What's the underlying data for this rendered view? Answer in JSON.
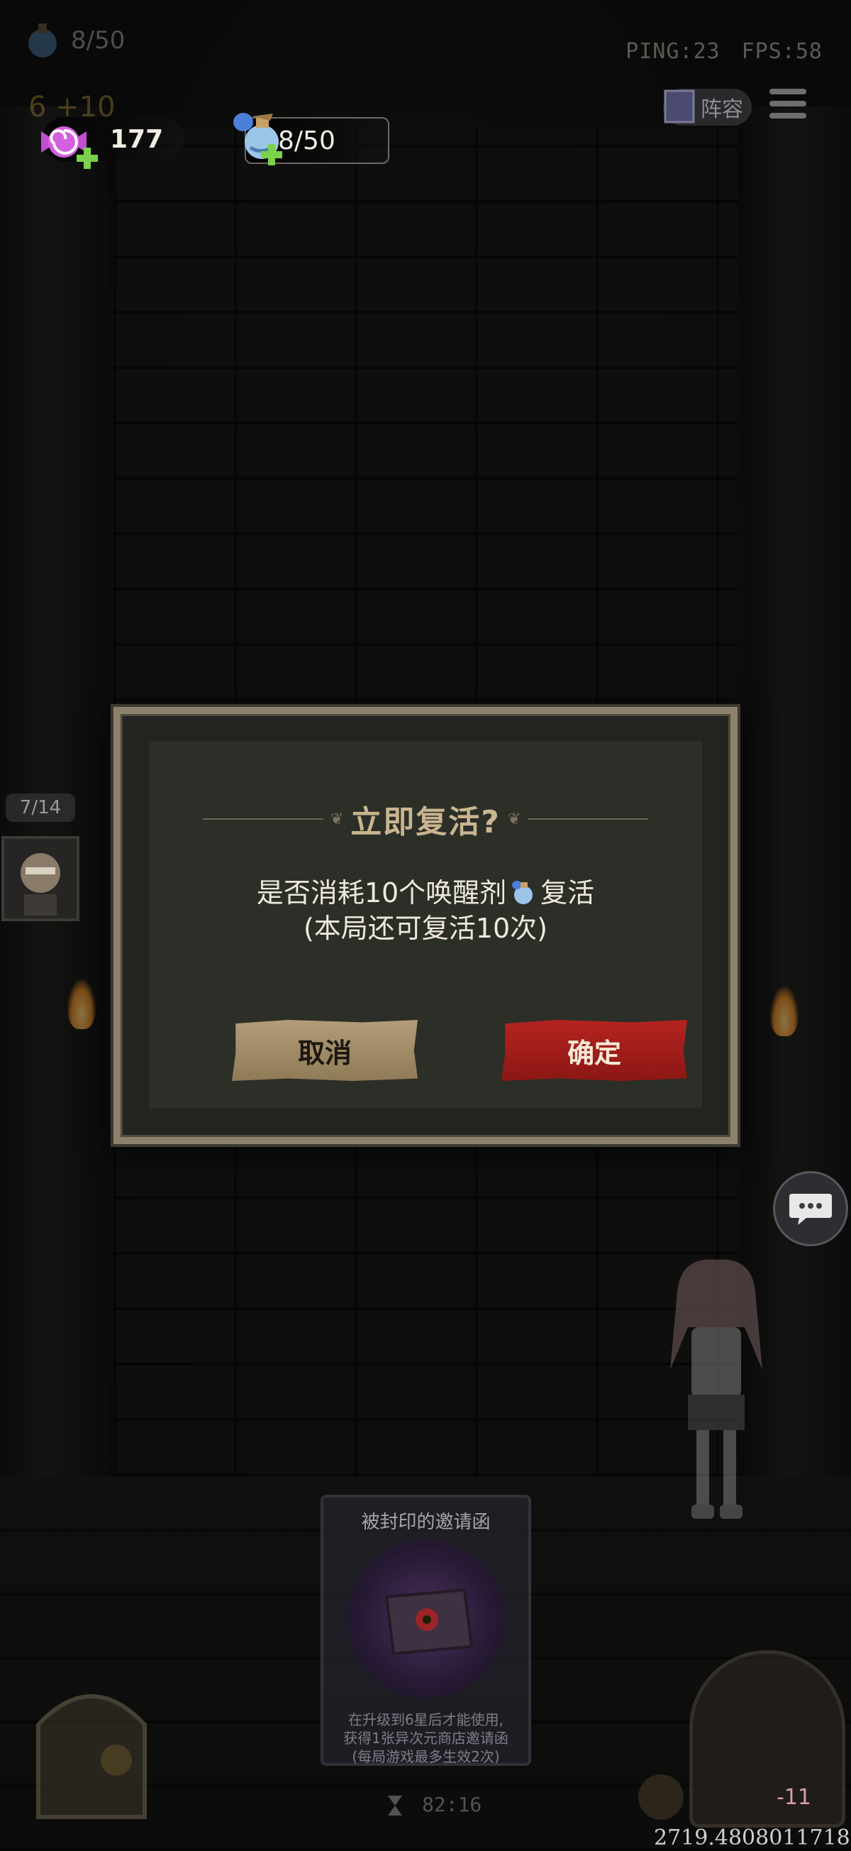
{
  "hud": {
    "ghost_potion_count": "8/50",
    "ghost_coins": "6 +10",
    "ping": "PING:23",
    "fps": "FPS:58",
    "candy_count": "177",
    "potion_count": "8/50",
    "team_label": "阵容"
  },
  "side": {
    "wave_counter": "7/14"
  },
  "dialog": {
    "title": "立即复活?",
    "message_part1": "是否消耗10个唤醒剂",
    "message_part2": "复活",
    "message_line2": "(本局还可复活10次)",
    "cancel_label": "取消",
    "confirm_label": "确定"
  },
  "card": {
    "title": "被封印的邀请函",
    "desc_line1": "在升级到6星后才能使用,",
    "desc_line2": "获得1张异次元商店邀请函",
    "desc_line3": "(每局游戏最多生效2次)"
  },
  "bottom": {
    "timer": "82:16",
    "coords": "2719.4808011718",
    "hp_delta": "-11"
  },
  "colors": {
    "confirm_red": "#b5231f",
    "cancel_tan": "#b39d78",
    "dialog_frame": "#8c826c",
    "title_gold": "#c9b58f"
  },
  "icons": {
    "candy": "candy-icon",
    "potion": "potion-icon",
    "plus": "plus-icon",
    "book": "book-icon",
    "menu": "menu-icon",
    "chat": "chat-icon",
    "hourglass": "hourglass-icon"
  }
}
